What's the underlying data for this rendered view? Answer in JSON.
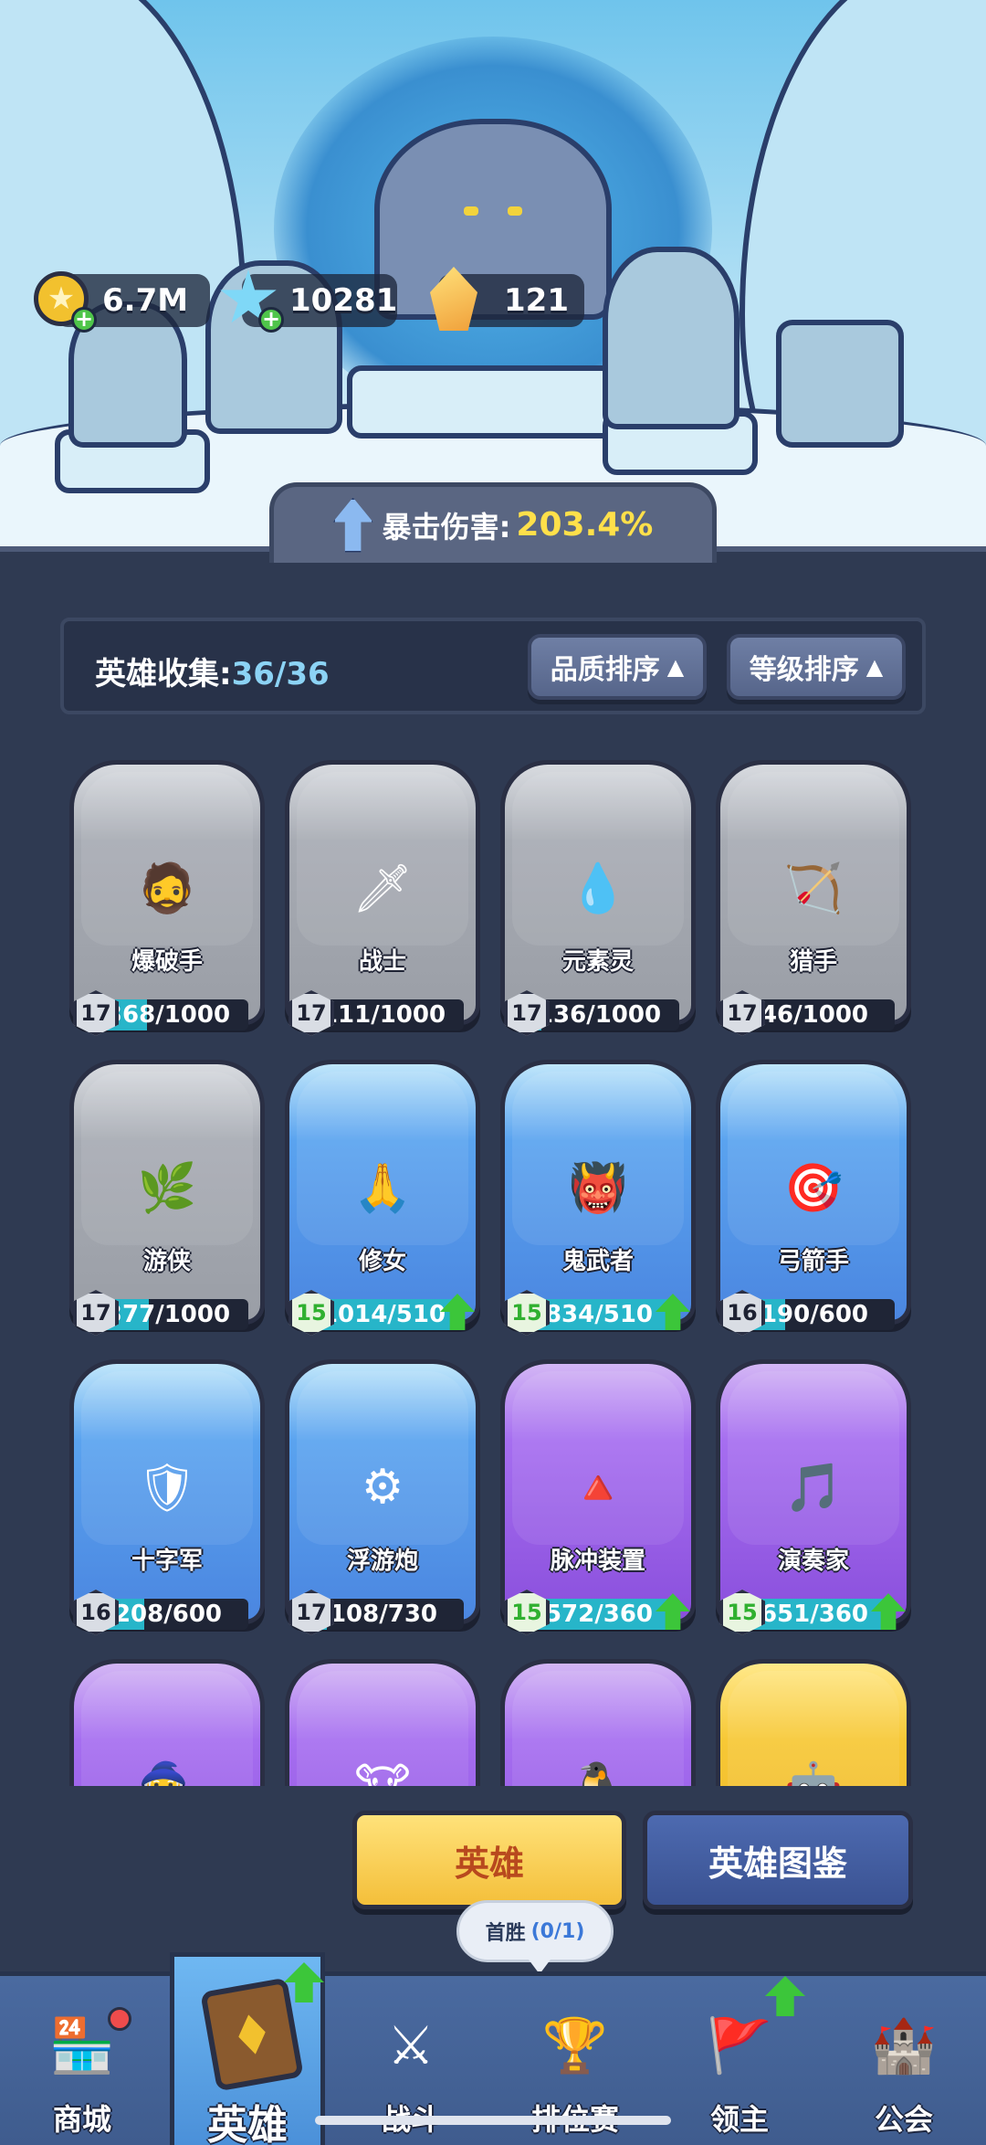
{
  "currencies": [
    {
      "icon": "gold-coin-icon",
      "value": "6.7M"
    },
    {
      "icon": "blue-gem-icon",
      "value": "10281"
    },
    {
      "icon": "orange-crystal-icon",
      "value": "121"
    }
  ],
  "crit": {
    "label": "暴击伤害:",
    "value": "203.4%"
  },
  "collection": {
    "label": "英雄收集:",
    "count": "36/36"
  },
  "sort": {
    "quality": "品质排序",
    "level": "等级排序",
    "arrow": "▲"
  },
  "heroes": [
    {
      "name": "爆破手",
      "rarity": "gray",
      "level": "17",
      "progress": "368/1000",
      "ratio": 0.368,
      "upgrade": false,
      "portrait": "🧔"
    },
    {
      "name": "战士",
      "rarity": "gray",
      "level": "17",
      "progress": "111/1000",
      "ratio": 0.111,
      "upgrade": false,
      "portrait": "🗡"
    },
    {
      "name": "元素灵",
      "rarity": "gray",
      "level": "17",
      "progress": "136/1000",
      "ratio": 0.136,
      "upgrade": false,
      "portrait": "💧"
    },
    {
      "name": "猎手",
      "rarity": "gray",
      "level": "17",
      "progress": "46/1000",
      "ratio": 0.046,
      "upgrade": false,
      "portrait": "🏹"
    },
    {
      "name": "游侠",
      "rarity": "gray",
      "level": "17",
      "progress": "377/1000",
      "ratio": 0.377,
      "upgrade": false,
      "portrait": "🌿"
    },
    {
      "name": "修女",
      "rarity": "blue",
      "level": "15",
      "progress": "1014/510",
      "ratio": 1,
      "upgrade": true,
      "portrait": "🙏"
    },
    {
      "name": "鬼武者",
      "rarity": "blue",
      "level": "15",
      "progress": "834/510",
      "ratio": 1,
      "upgrade": true,
      "portrait": "👹"
    },
    {
      "name": "弓箭手",
      "rarity": "blue",
      "level": "16",
      "progress": "190/600",
      "ratio": 0.317,
      "upgrade": false,
      "portrait": "🎯"
    },
    {
      "name": "十字军",
      "rarity": "blue",
      "level": "16",
      "progress": "208/600",
      "ratio": 0.347,
      "upgrade": false,
      "portrait": "🛡"
    },
    {
      "name": "浮游炮",
      "rarity": "blue",
      "level": "17",
      "progress": "108/730",
      "ratio": 0.148,
      "upgrade": false,
      "portrait": "⚙"
    },
    {
      "name": "脉冲装置",
      "rarity": "purple",
      "level": "15",
      "progress": "572/360",
      "ratio": 1,
      "upgrade": true,
      "portrait": "🔺"
    },
    {
      "name": "演奏家",
      "rarity": "purple",
      "level": "15",
      "progress": "651/360",
      "ratio": 1,
      "upgrade": true,
      "portrait": "🎵"
    },
    {
      "name": "",
      "rarity": "purple",
      "level": "",
      "progress": "",
      "ratio": 0,
      "upgrade": false,
      "portrait": "🧙"
    },
    {
      "name": "",
      "rarity": "purple",
      "level": "",
      "progress": "",
      "ratio": 0,
      "upgrade": false,
      "portrait": "🐮"
    },
    {
      "name": "",
      "rarity": "purple",
      "level": "",
      "progress": "",
      "ratio": 0,
      "upgrade": false,
      "portrait": "🐧"
    },
    {
      "name": "",
      "rarity": "gold",
      "level": "",
      "progress": "",
      "ratio": 0,
      "upgrade": false,
      "portrait": "🤖"
    }
  ],
  "buttons": {
    "hero": "英雄",
    "codex": "英雄图鉴"
  },
  "tooltip": {
    "label": "首胜",
    "progress": "(0/1)"
  },
  "nav": [
    {
      "label": "商城",
      "icon": "shop-icon",
      "glyph": "🏪"
    },
    {
      "label": "英雄",
      "icon": "hero-card-icon",
      "glyph": ""
    },
    {
      "label": "战斗",
      "icon": "crossed-swords-icon",
      "glyph": "⚔"
    },
    {
      "label": "排位赛",
      "icon": "ranked-shield-icon",
      "glyph": "🏆"
    },
    {
      "label": "领主",
      "icon": "lord-banner-icon",
      "glyph": "🚩"
    },
    {
      "label": "公会",
      "icon": "guild-tower-icon",
      "glyph": "🏰"
    }
  ]
}
